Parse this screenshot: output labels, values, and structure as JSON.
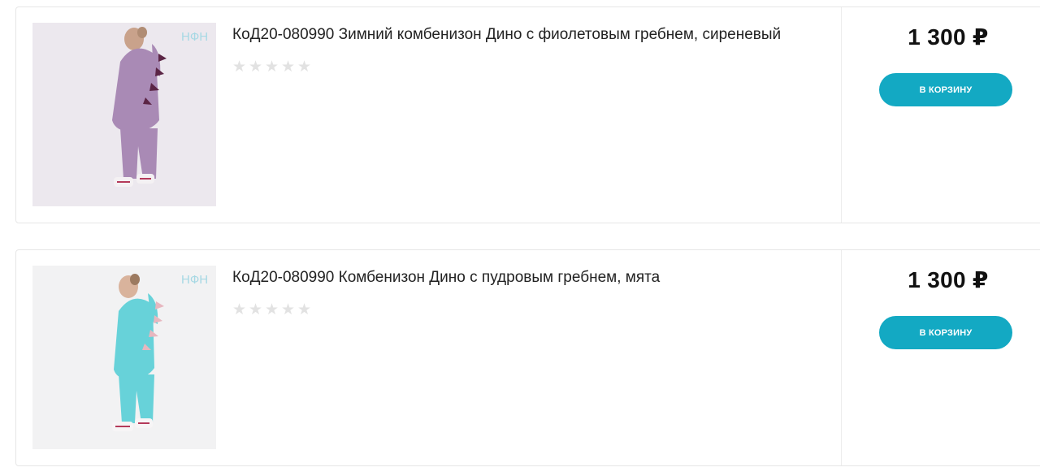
{
  "products": [
    {
      "title": "КоД20-080990 Зимний комбенизон Дино с фиолетовым гребнем, сиреневый",
      "rating": 0,
      "max_rating": 5,
      "price": "1 300 ₽",
      "cart_label": "В КОРЗИНУ",
      "image_watermark": "НФН",
      "suit_color": "#a98ab5",
      "spike_color": "#5b2545"
    },
    {
      "title": "КоД20-080990 Комбенизон Дино с пудровым гребнем, мята",
      "rating": 0,
      "max_rating": 5,
      "price": "1 300 ₽",
      "cart_label": "В КОРЗИНУ",
      "image_watermark": "НФН",
      "suit_color": "#67d2d9",
      "spike_color": "#e7b7bf"
    }
  ],
  "colors": {
    "accent": "#13a9c3",
    "star_empty": "#e2e2e2",
    "border": "#e6e6e6"
  }
}
